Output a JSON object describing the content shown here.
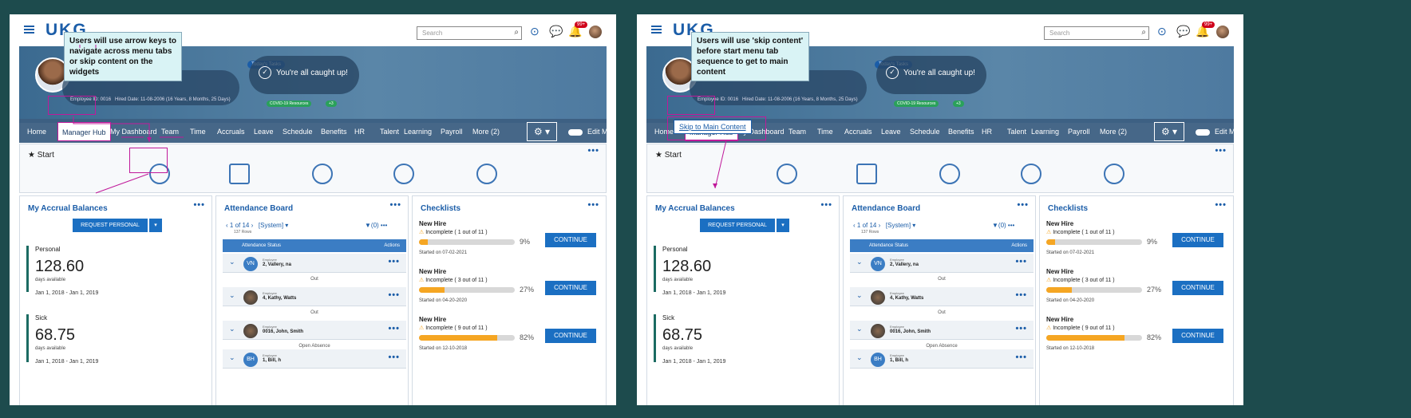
{
  "left": {
    "annotation": "Users will use arrow keys to navigate across menu tabs or skip content on the widgets",
    "skip_link": ""
  },
  "right": {
    "annotation": "Users will use 'skip content' before start menu tab sequence to get to main content",
    "skip_link": "Skip to Main Content"
  },
  "app": {
    "logo": "UKG",
    "search_placeholder": "Search",
    "notif_count": "99+",
    "todays_tasks": "Today's Tasks",
    "caught_up": "You're all caught up!",
    "covid_chip": "COVID-19 Resources",
    "covid_plus": "+3",
    "employee_id": "Employee ID: 0016",
    "hire_date": "Hired Date: 11-08-2006 (16 Years, 8 Months, 25 Days)",
    "nav": [
      "Home",
      "Manager Hub",
      "My Dashboard",
      "Team",
      "Time",
      "Accruals",
      "Leave",
      "Schedule",
      "Benefits",
      "HR",
      "Talent",
      "Learning",
      "Payroll",
      "More (2)"
    ],
    "edit_mode": "Edit Mode",
    "start": "Start",
    "accrual": {
      "title": "My Accrual Balances",
      "request_btn": "REQUEST PERSONAL",
      "personal_label": "Personal",
      "personal_value": "128.60",
      "personal_unit": "days available",
      "personal_dates": "Jan 1, 2018 - Jan 1, 2019",
      "sick_label": "Sick",
      "sick_value": "68.75",
      "sick_unit": "days available",
      "sick_dates": "Jan 1, 2018 - Jan 1, 2019"
    },
    "attendance": {
      "title": "Attendance Board",
      "pager": "1 of 14",
      "rows_count": "137 Rows",
      "system": "[System]",
      "filter": "(0)",
      "col_status": "Attendance Status",
      "col_actions": "Actions",
      "employee_cap": "Employee",
      "rows": [
        {
          "initials": "VN",
          "name": "2, Vallery, na",
          "sub": "Out"
        },
        {
          "initials": "",
          "name": "4, Kathy, Watts",
          "sub": "Out"
        },
        {
          "initials": "",
          "name": "0016, John, Smith",
          "sub": "Open Absence"
        },
        {
          "initials": "BH",
          "name": "1, Bill, h",
          "sub": ""
        }
      ]
    },
    "checklists": {
      "title": "Checklists",
      "continue": "CONTINUE",
      "items": [
        {
          "title": "New Hire",
          "status": "Incomplete ( 1 out of 11 )",
          "pct": "9%",
          "fill": 9,
          "started": "Started on 07-02-2021"
        },
        {
          "title": "New Hire",
          "status": "Incomplete ( 3 out of 11 )",
          "pct": "27%",
          "fill": 27,
          "started": "Started on 04-20-2020"
        },
        {
          "title": "New Hire",
          "status": "Incomplete ( 9 out of 11 )",
          "pct": "82%",
          "fill": 82,
          "started": "Started on 12-10-2018"
        }
      ]
    }
  }
}
